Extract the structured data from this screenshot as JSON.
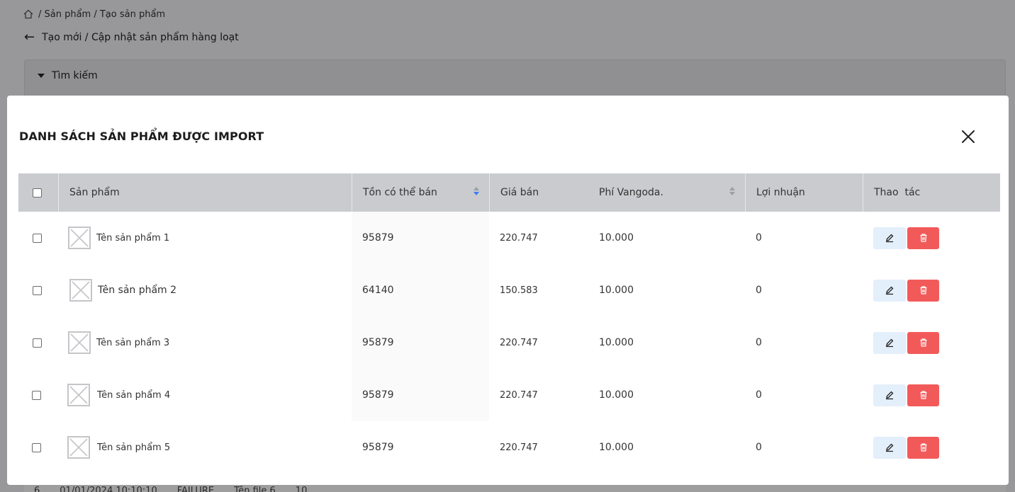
{
  "breadcrumb": {
    "path": "/ Sản phẩm / Tạo sản phẩm"
  },
  "page": {
    "title": "Tạo mới / Cập nhật sản phẩm hàng loạt"
  },
  "search": {
    "label": "Tìm kiếm"
  },
  "bg_row": {
    "index": "6",
    "date": "01/01/2024 10:10:10",
    "status": "FAILURE",
    "file": "Tên file 6",
    "count": "10"
  },
  "modal": {
    "title": "DANH SÁCH SẢN PHẨM ĐƯỢC IMPORT",
    "columns": {
      "product": "Sản phẩm",
      "stock": "Tồn có thể bán",
      "price": "Giá bán",
      "fee": "Phí Vangoda.",
      "profit": "Lợi nhuận",
      "actions": "Thao  tác"
    },
    "rows": [
      {
        "name": "Tên sản phẩm 1",
        "stock": "95879",
        "price": "220.747",
        "fee": "10.000",
        "profit": "0"
      },
      {
        "name": "Tên sản phẩm 2",
        "stock": "64140",
        "price": "150.583",
        "fee": "10.000",
        "profit": "0"
      },
      {
        "name": "Tên sản phẩm 3",
        "stock": "95879",
        "price": "220.747",
        "fee": "10.000",
        "profit": "0"
      },
      {
        "name": "Tên sản phẩm 4",
        "stock": "95879",
        "price": "220.747",
        "fee": "10.000",
        "profit": "0"
      },
      {
        "name": "Tên sản phẩm 5",
        "stock": "95879",
        "price": "220.747",
        "fee": "10.000",
        "profit": "0"
      }
    ]
  },
  "colors": {
    "delete": "#f25a5a",
    "edit_bg": "#e3effa",
    "header_bg": "#c9cbcf",
    "sort_active": "#3d7bf0"
  },
  "icons": {
    "home": "home-icon",
    "back": "arrow-left-icon",
    "close": "close-icon",
    "edit": "pencil-icon",
    "delete": "trash-icon",
    "placeholder": "image-placeholder-icon"
  }
}
